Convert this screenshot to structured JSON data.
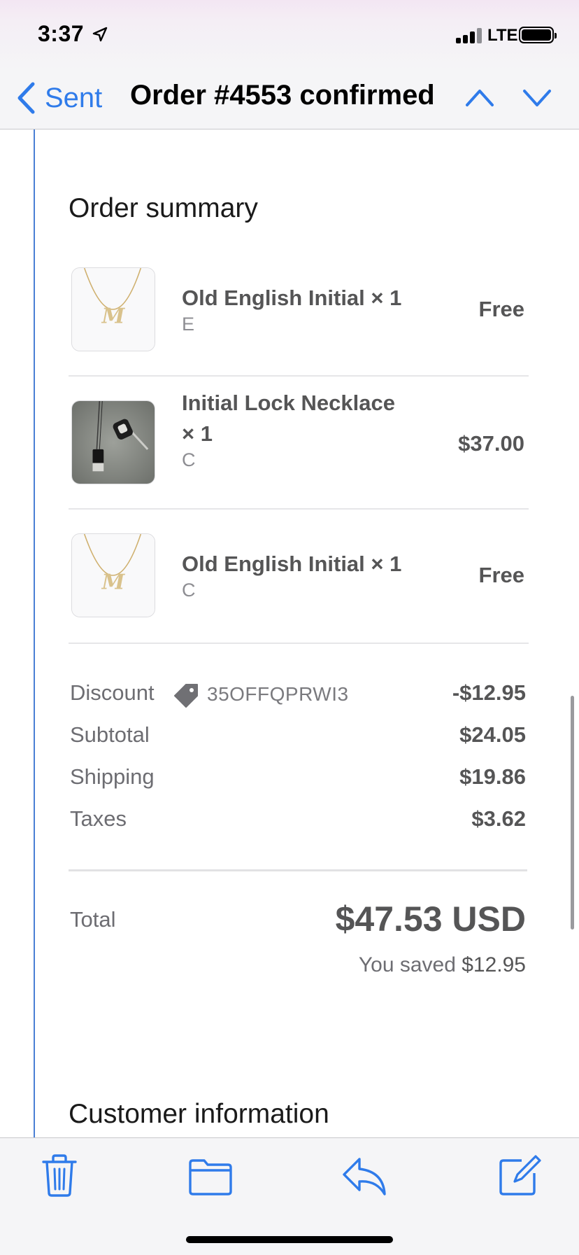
{
  "status_bar": {
    "time": "3:37",
    "network": "LTE"
  },
  "nav": {
    "back_label": "Sent",
    "title": "Order #4553 confirmed"
  },
  "order_summary": {
    "title": "Order summary",
    "items": [
      {
        "name": "Old English Initial × 1",
        "variant": "E",
        "price": "Free",
        "image": "gold-initial-necklace"
      },
      {
        "name": "Initial Lock Necklace × 1",
        "variant": "C",
        "price": "$37.00",
        "image": "lock-necklace-photo"
      },
      {
        "name": "Old English Initial × 1",
        "variant": "C",
        "price": "Free",
        "image": "gold-initial-necklace"
      }
    ],
    "discount": {
      "label": "Discount",
      "code": "35OFFQPRWI3",
      "value": "-$12.95"
    },
    "subtotal": {
      "label": "Subtotal",
      "value": "$24.05"
    },
    "shipping": {
      "label": "Shipping",
      "value": "$19.86"
    },
    "taxes": {
      "label": "Taxes",
      "value": "$3.62"
    },
    "total": {
      "label": "Total",
      "value": "$47.53 USD"
    },
    "saved": {
      "prefix": "You saved",
      "amount": "$12.95"
    }
  },
  "customer_info": {
    "title": "Customer information"
  },
  "toolbar": {
    "icons": [
      "trash-icon",
      "folder-icon",
      "reply-icon",
      "compose-icon"
    ]
  },
  "colors": {
    "accent": "#2f7bea",
    "text_muted": "#6d6d72",
    "text_strong": "#555556"
  }
}
